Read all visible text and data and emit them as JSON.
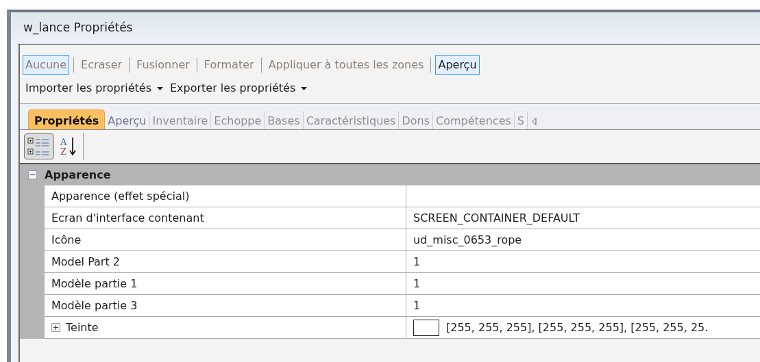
{
  "window": {
    "title": "w_lance Propriétés"
  },
  "toolbar": [
    {
      "label": "Aucune",
      "selected": true,
      "disabled": true
    },
    {
      "label": "Ecraser",
      "selected": false,
      "disabled": true
    },
    {
      "label": "Fusionner",
      "selected": false,
      "disabled": true
    },
    {
      "label": "Formater",
      "selected": false,
      "disabled": true
    },
    {
      "label": "Appliquer à toutes les zones",
      "selected": false,
      "disabled": true
    },
    {
      "label": "Aperçu",
      "selected": true,
      "disabled": false
    }
  ],
  "menus": [
    {
      "label": "Importer les propriétés"
    },
    {
      "label": "Exporter les propriétés"
    }
  ],
  "tabs": [
    {
      "label": "Propriétés",
      "selected": true,
      "disabled": false
    },
    {
      "label": "Aperçu",
      "selected": false,
      "disabled": false
    },
    {
      "label": "Inventaire",
      "selected": false,
      "disabled": true
    },
    {
      "label": "Echoppe",
      "selected": false,
      "disabled": true
    },
    {
      "label": "Bases",
      "selected": false,
      "disabled": true
    },
    {
      "label": "Caractéristiques",
      "selected": false,
      "disabled": true
    },
    {
      "label": "Dons",
      "selected": false,
      "disabled": true
    },
    {
      "label": "Compétences",
      "selected": false,
      "disabled": true
    },
    {
      "label": "S",
      "selected": false,
      "disabled": true
    }
  ],
  "grid_toolbar": [
    {
      "kind": "categorized",
      "selected": true
    },
    {
      "kind": "alphabetical",
      "selected": false,
      "glyphs": [
        "A",
        "Z"
      ]
    }
  ],
  "categories": [
    {
      "name": "Apparence",
      "expanded": true,
      "rows": [
        {
          "name": "Apparence (effet spécial)",
          "value": "",
          "kind": "text"
        },
        {
          "name": "Ecran d'interface contenant",
          "value": "SCREEN_CONTAINER_DEFAULT",
          "kind": "text"
        },
        {
          "name": "Icône",
          "value": "ud_misc_0653_rope",
          "kind": "text"
        },
        {
          "name": "Model Part 2",
          "value": "1",
          "kind": "text"
        },
        {
          "name": "Modèle partie 1",
          "value": "1",
          "kind": "text"
        },
        {
          "name": "Modèle partie 3",
          "value": "1",
          "kind": "text"
        },
        {
          "name": "Teinte",
          "value": "[255, 255, 255], [255, 255, 255], [255, 255, 25.",
          "kind": "color",
          "expanded": false,
          "color": "#ffffff"
        }
      ]
    }
  ]
}
